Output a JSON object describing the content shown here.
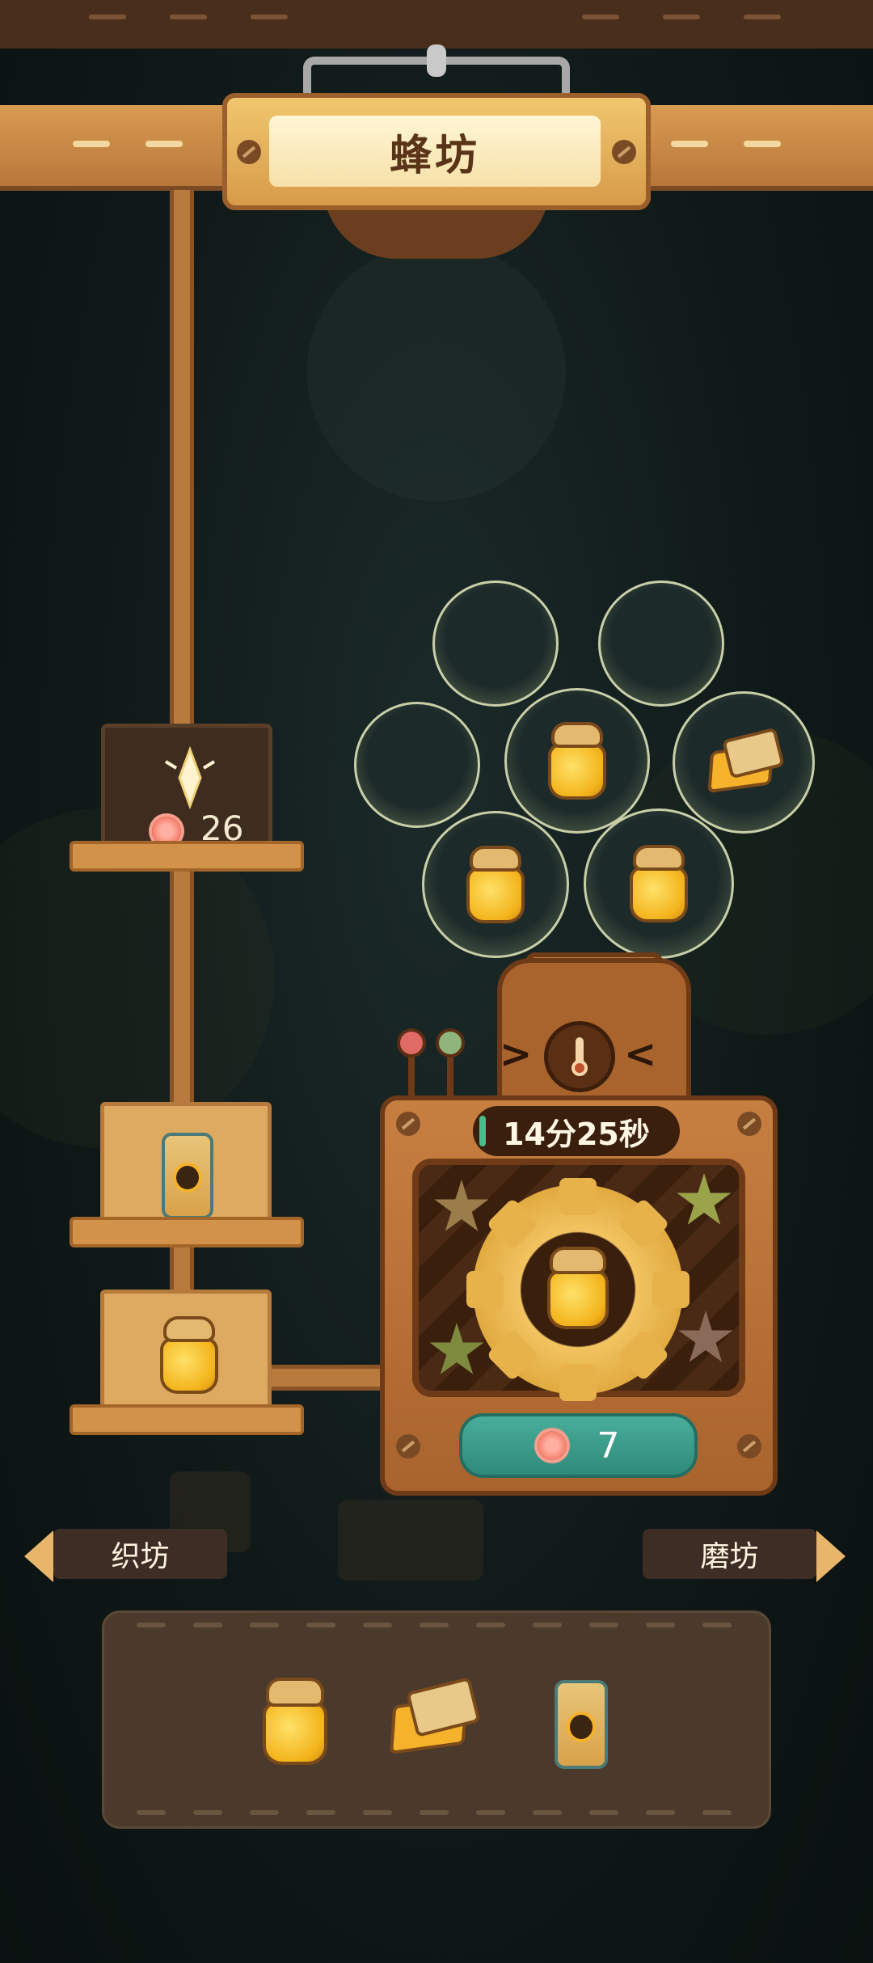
{
  "header": {
    "title": "蜂坊",
    "hanger_icon": "hanger-icon"
  },
  "resources": {
    "count": "26",
    "icon": "sparkle-crystal-icon",
    "currency_icon": "flower-token-icon"
  },
  "queue": {
    "items": [
      {
        "icon": "bee-jar-icon"
      },
      {
        "icon": "honey-jar-icon"
      }
    ]
  },
  "bubbles": [
    {
      "slot": "empty"
    },
    {
      "slot": "empty"
    },
    {
      "slot": "empty"
    },
    {
      "slot": "honey-jar-icon"
    },
    {
      "slot": "honeycomb-box-icon"
    },
    {
      "slot": "honey-jar-icon"
    },
    {
      "slot": "honey-jar-icon"
    }
  ],
  "machine": {
    "timer": "14分25秒",
    "product_icon": "honey-jar-icon",
    "cost": "7",
    "cost_icon": "flower-token-icon",
    "temperature_icon": "thermometer-icon"
  },
  "nav": {
    "left": "织坊",
    "right": "磨坊"
  },
  "inventory": {
    "items": [
      {
        "icon": "honey-jar-icon"
      },
      {
        "icon": "honeycomb-box-icon"
      },
      {
        "icon": "bee-jar-icon"
      }
    ]
  },
  "colors": {
    "wood": "#b97a3e",
    "accent_teal": "#3a9a87",
    "honey": "#f3b41c",
    "background": "#0f1918"
  }
}
